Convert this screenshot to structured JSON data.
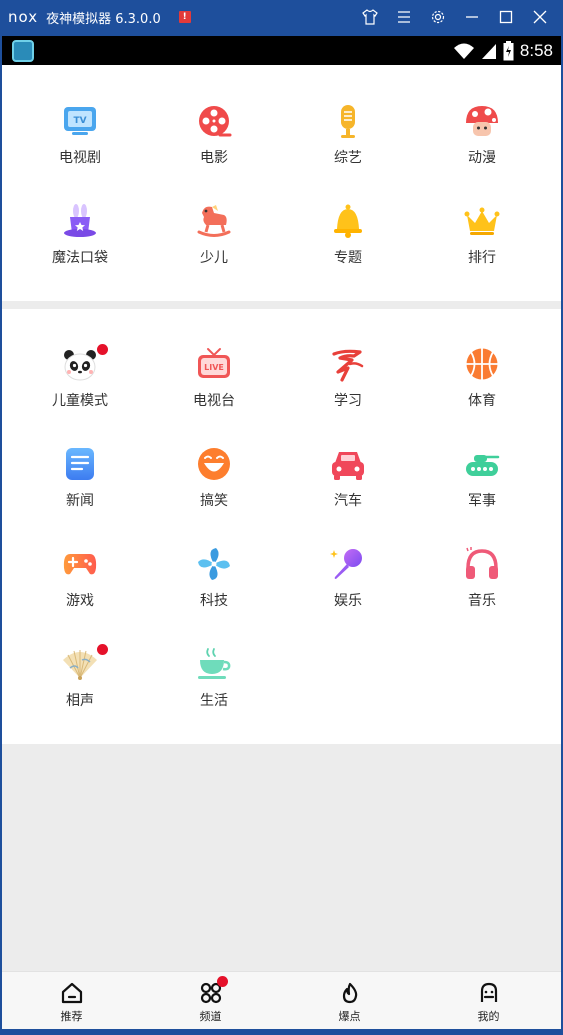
{
  "window": {
    "logo": "nox",
    "title": "夜神模拟器 6.3.0.0",
    "alert": "!",
    "controls": [
      "shirt-icon",
      "menu-icon",
      "gear-icon",
      "minimize-icon",
      "maximize-icon",
      "close-icon"
    ]
  },
  "status_bar": {
    "time": "8:58",
    "icons": [
      "wifi-icon",
      "signal-icon",
      "battery-icon"
    ]
  },
  "section1": {
    "items": [
      {
        "label": "电视剧",
        "icon": "tv-icon"
      },
      {
        "label": "电影",
        "icon": "film-reel-icon"
      },
      {
        "label": "综艺",
        "icon": "microphone-icon"
      },
      {
        "label": "动漫",
        "icon": "mushroom-icon"
      },
      {
        "label": "魔法口袋",
        "icon": "magic-hat-icon"
      },
      {
        "label": "少儿",
        "icon": "rocking-horse-icon"
      },
      {
        "label": "专题",
        "icon": "bell-icon"
      },
      {
        "label": "排行",
        "icon": "crown-icon"
      }
    ]
  },
  "section2": {
    "items": [
      {
        "label": "儿童模式",
        "icon": "panda-icon",
        "badge": true
      },
      {
        "label": "电视台",
        "icon": "live-tv-icon"
      },
      {
        "label": "学习",
        "icon": "calligraphy-icon"
      },
      {
        "label": "体育",
        "icon": "basketball-icon"
      },
      {
        "label": "新闻",
        "icon": "document-icon"
      },
      {
        "label": "搞笑",
        "icon": "laughing-face-icon"
      },
      {
        "label": "汽车",
        "icon": "car-icon"
      },
      {
        "label": "军事",
        "icon": "tank-icon"
      },
      {
        "label": "游戏",
        "icon": "gamepad-icon"
      },
      {
        "label": "科技",
        "icon": "pinwheel-icon"
      },
      {
        "label": "娱乐",
        "icon": "karaoke-mic-icon"
      },
      {
        "label": "音乐",
        "icon": "headphones-icon"
      },
      {
        "label": "相声",
        "icon": "folding-fan-icon",
        "badge": true
      },
      {
        "label": "生活",
        "icon": "teacup-icon"
      }
    ]
  },
  "bottom_nav": {
    "items": [
      {
        "label": "推荐",
        "icon": "home-icon"
      },
      {
        "label": "频道",
        "icon": "channels-icon",
        "badge": true
      },
      {
        "label": "爆点",
        "icon": "flame-icon"
      },
      {
        "label": "我的",
        "icon": "profile-icon"
      }
    ]
  },
  "colors": {
    "window_frame": "#1e4f9c",
    "badge_red": "#e5112a",
    "page_bg": "#ececec"
  }
}
